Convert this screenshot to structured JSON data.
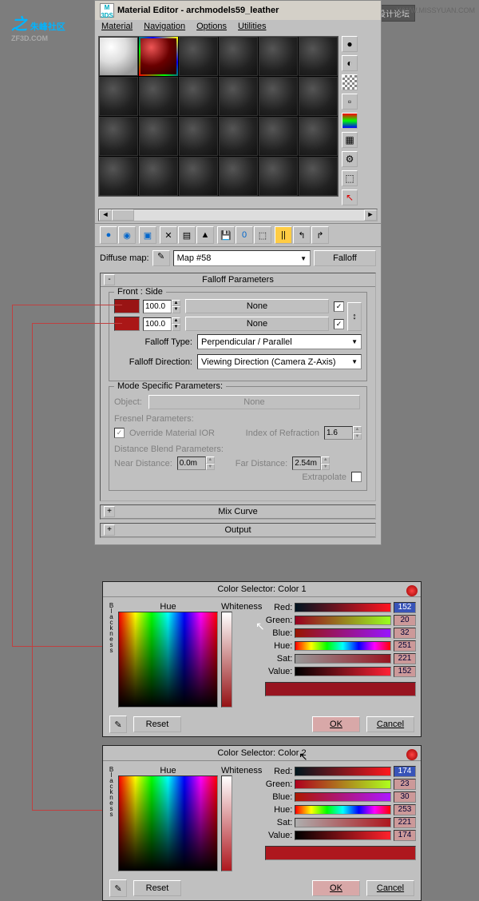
{
  "logo": {
    "main": "朱峰社区",
    "sub": "ZF3D.COM"
  },
  "watermark1": "思缘设计论坛",
  "watermark2": "WWW.MISSYUAN.COM",
  "window": {
    "icon": "M 3DS",
    "title": "Material Editor - archmodels59_leather",
    "menu": [
      "Material",
      "Navigation",
      "Options",
      "Utilities"
    ],
    "map_row": {
      "label": "Diffuse map:",
      "value": "Map #58",
      "button": "Falloff"
    },
    "rollouts": {
      "falloff": {
        "title": "Falloff Parameters",
        "front_side": "Front : Side",
        "color1": "#991414",
        "color2": "#aa1717",
        "amt1": "100.0",
        "amt2": "100.0",
        "none": "None",
        "type_label": "Falloff Type:",
        "type_value": "Perpendicular / Parallel",
        "dir_label": "Falloff Direction:",
        "dir_value": "Viewing Direction (Camera Z-Axis)"
      },
      "mode": {
        "title": "Mode Specific Parameters:",
        "object_label": "Object:",
        "object_value": "None",
        "fresnel": "Fresnel Parameters:",
        "override": "Override Material IOR",
        "ior_label": "Index of Refraction",
        "ior_value": "1.6",
        "dist": "Distance Blend Parameters:",
        "near_label": "Near Distance:",
        "near_value": "0.0m",
        "far_label": "Far Distance:",
        "far_value": "2.54m",
        "extrapolate": "Extrapolate"
      },
      "mix": "Mix Curve",
      "output": "Output"
    }
  },
  "color1": {
    "title": "Color Selector: Color 1",
    "hue": "Hue",
    "whiteness": "Whiteness",
    "blackness": "Blackness",
    "labels": {
      "r": "Red:",
      "g": "Green:",
      "b": "Blue:",
      "h": "Hue:",
      "s": "Sat:",
      "v": "Value:"
    },
    "vals": {
      "r": "152",
      "g": "20",
      "b": "32",
      "h": "251",
      "s": "221",
      "v": "152"
    },
    "result": "#981420",
    "reset": "Reset",
    "ok": "OK",
    "cancel": "Cancel"
  },
  "color2": {
    "title": "Color Selector: Color 2",
    "hue": "Hue",
    "whiteness": "Whiteness",
    "blackness": "Blackness",
    "labels": {
      "r": "Red:",
      "g": "Green:",
      "b": "Blue:",
      "h": "Hue:",
      "s": "Sat:",
      "v": "Value:"
    },
    "vals": {
      "r": "174",
      "g": "23",
      "b": "30",
      "h": "253",
      "s": "221",
      "v": "174"
    },
    "result": "#ae171e",
    "reset": "Reset",
    "ok": "OK",
    "cancel": "Cancel"
  }
}
